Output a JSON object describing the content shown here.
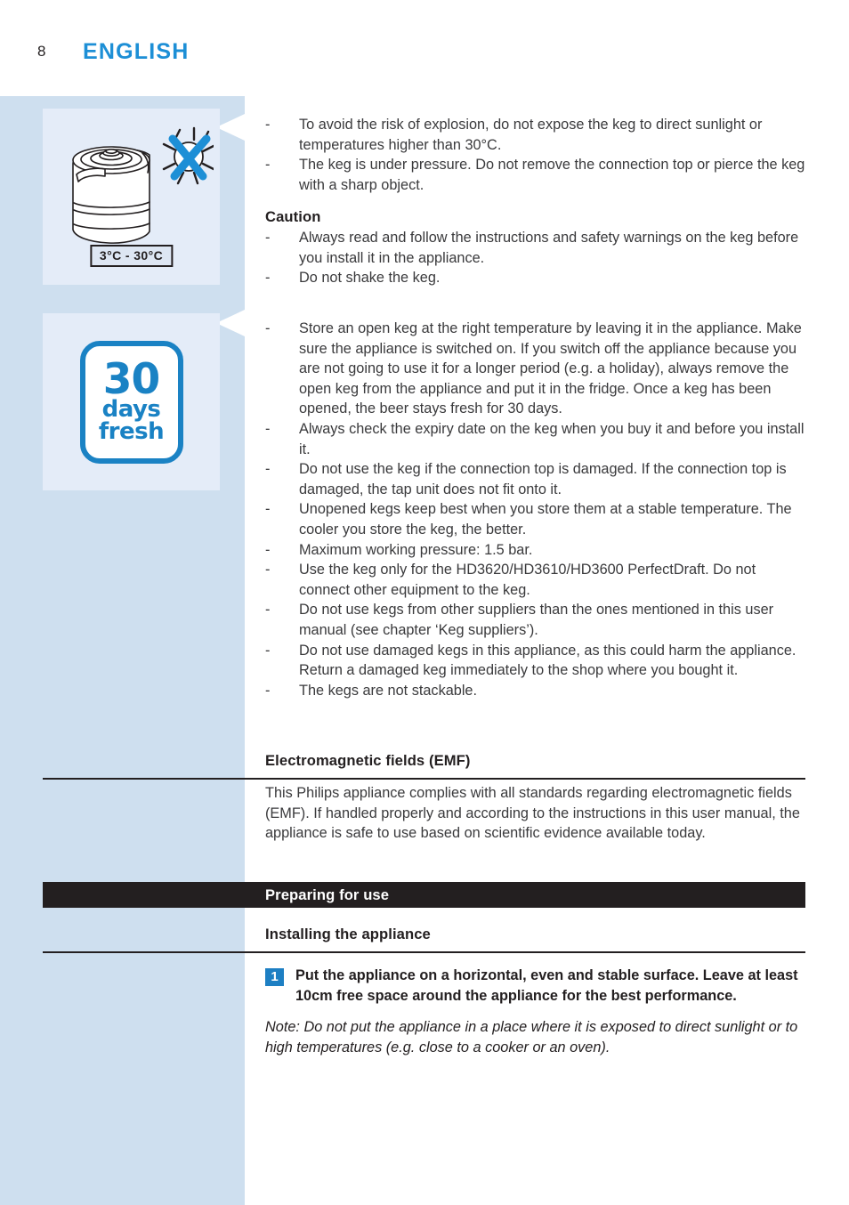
{
  "header": {
    "page_number": "8",
    "language": "ENGLISH"
  },
  "colors": {
    "accent_blue": "#1d8fd6",
    "sidebar_blue": "#cedfef",
    "illustration_blue": "#e4ecf8",
    "bar_black": "#231f20",
    "badge_blue": "#1d7fc3",
    "logo_blue": "#1a82c4"
  },
  "illustrations": [
    {
      "name": "keg-no-sunlight",
      "temperature_label": "3°C - 30°C"
    },
    {
      "name": "30-days-fresh-badge",
      "line1": "30",
      "line2": "days",
      "line3": "fresh"
    }
  ],
  "warnings": {
    "bullets": [
      "To avoid the risk of explosion, do not expose the keg to direct sunlight or temperatures higher than 30°C.",
      "The keg is under pressure. Do not remove the connection top or pierce the keg with a sharp object."
    ]
  },
  "caution": {
    "heading": "Caution",
    "bullets": [
      "Always read and follow the instructions and safety warnings on the keg before you install it in the appliance.",
      "Do not shake the keg."
    ]
  },
  "keg_care": {
    "bullets": [
      "Store an open keg at the right temperature by leaving it in the appliance. Make sure the appliance is switched on. If you switch off the appliance because you are not going to use it for a longer period (e.g. a holiday), always remove the open keg from the appliance and put it in the fridge. Once a keg has been opened, the beer stays fresh for 30 days.",
      "Always check the expiry date on the keg when you buy it and before you install it.",
      "Do not use the keg if the connection top is damaged. If the connection top is damaged, the tap unit does not fit onto it.",
      "Unopened kegs keep best when you store them at a stable temperature. The cooler you store the keg, the better.",
      "Maximum working pressure: 1.5 bar.",
      "Use the keg only for the HD3620/HD3610/HD3600 PerfectDraft. Do not connect other equipment to the keg.",
      "Do not use kegs from other suppliers than the ones mentioned in this user manual (see chapter ‘Keg suppliers’).",
      "Do not use damaged kegs in this appliance, as this could harm the appliance. Return a damaged keg immediately to the shop where you bought it.",
      "The kegs are not stackable."
    ],
    "dash": "-"
  },
  "emf": {
    "heading": "Electromagnetic fields (EMF)",
    "paragraph": "This Philips appliance complies with all standards regarding electromagnetic fields (EMF). If handled properly and according to the instructions in this user manual, the appliance is safe to use based on scientific evidence available today."
  },
  "chapter": {
    "title": "Preparing for use"
  },
  "installing": {
    "heading": "Installing the appliance",
    "step_number": "1",
    "step_text": "Put the appliance on a horizontal, even and stable surface. Leave at least 10cm free space around the appliance for the best performance.",
    "note": "Note: Do not put the appliance in a place where it is exposed to direct sunlight or to high temperatures (e.g. close to a cooker or an oven)."
  }
}
